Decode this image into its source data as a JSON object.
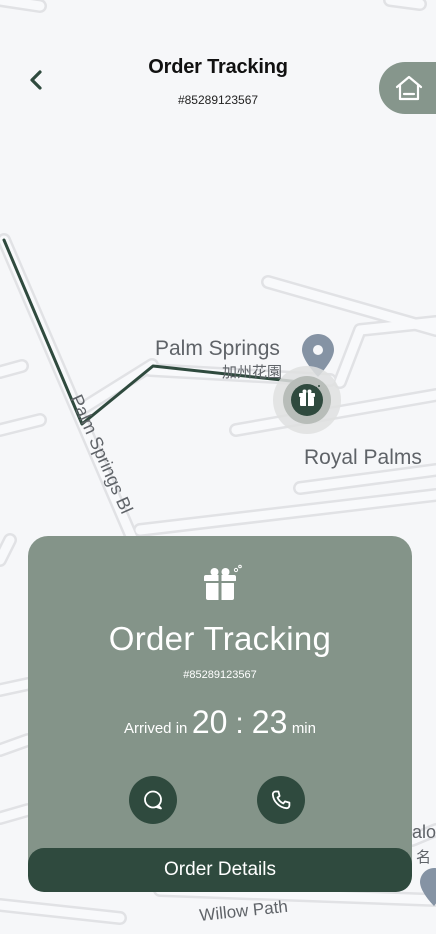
{
  "header": {
    "title": "Order Tracking",
    "order_number": "#85289123567"
  },
  "map": {
    "labels": {
      "palm_springs": "Palm Springs",
      "palm_springs_cn": "加州花園",
      "royal_palms": "Royal Palms",
      "palm_springs_blvd": "Palm Springs Bl",
      "willow_path": "Willow Path",
      "edge_right_1": "alo",
      "edge_right_2": "名"
    }
  },
  "card": {
    "title": "Order Tracking",
    "order_number": "#85289123567",
    "arrived_label": "Arrived in",
    "minutes": "20",
    "separator": ":",
    "seconds": "23",
    "unit": "min",
    "details_button": "Order Details"
  },
  "colors": {
    "card_bg": "#849489",
    "accent_dark": "#2f4a3e",
    "route": "#2f4a3e",
    "home_button": "#86968c",
    "map_bg": "#f6f7f9",
    "road": "#e2e3e6"
  }
}
